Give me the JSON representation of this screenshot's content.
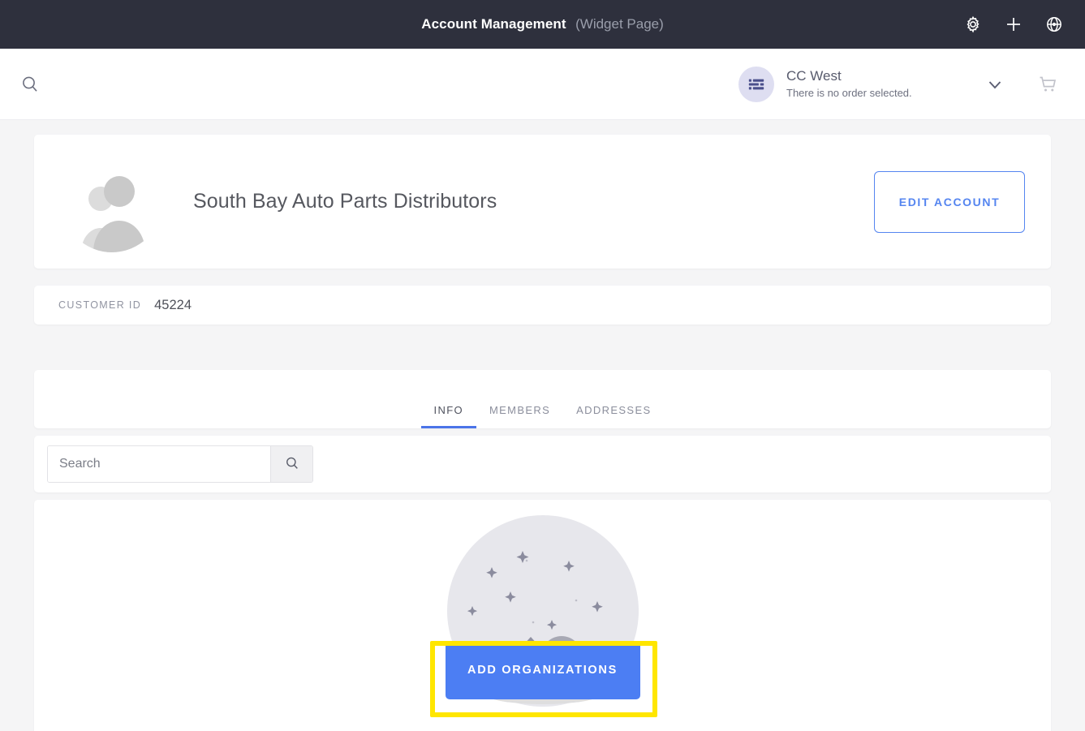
{
  "appbar": {
    "title": "Account Management",
    "subtitle": "(Widget Page)",
    "actions": [
      {
        "name": "gear-icon",
        "label": "Settings"
      },
      {
        "name": "plus-icon",
        "label": "Add"
      },
      {
        "name": "target-icon",
        "label": "Locate"
      }
    ],
    "bg_color": "#2e303d"
  },
  "subbar": {
    "search_icon": "search-icon",
    "order": {
      "avatar_icon": "order-list-icon",
      "name": "CC West",
      "status": "There is no order selected.",
      "chevron_icon": "chevron-down-icon"
    },
    "cart_icon": "cart-icon"
  },
  "account": {
    "avatar_icon": "group-avatar-icon",
    "name": "South Bay Auto Parts Distributors",
    "edit_button_label": "EDIT ACCOUNT",
    "accent_color": "#5585f0"
  },
  "customer": {
    "id_label": "CUSTOMER ID",
    "id_value": "45224"
  },
  "tabs": [
    {
      "label": "INFO",
      "active": true
    },
    {
      "label": "MEMBERS",
      "active": false
    },
    {
      "label": "ADDRESSES",
      "active": false
    }
  ],
  "search": {
    "value": "",
    "placeholder": "Search",
    "button_icon": "search-icon"
  },
  "empty_state": {
    "illustration": "empty-space-telescope-illustration",
    "button_label": "ADD ORGANIZATIONS",
    "button_color": "#4c7ef3"
  },
  "highlight": {
    "name": "add-organizations-highlight",
    "color": "#ffe600"
  }
}
